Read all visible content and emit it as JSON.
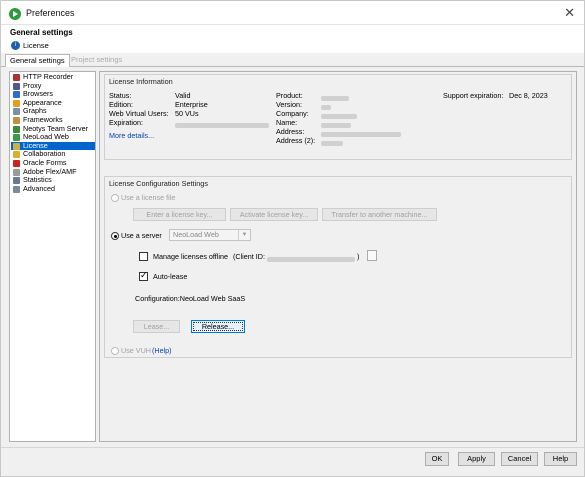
{
  "window": {
    "title": "Preferences",
    "close_glyph": "✕"
  },
  "header": {
    "title": "General settings",
    "subtitle": "License",
    "icon": "info-icon"
  },
  "tabs": [
    {
      "label": "General settings",
      "active": true
    },
    {
      "label": "Project settings",
      "active": false
    }
  ],
  "tree": {
    "items": [
      {
        "label": "HTTP Recorder",
        "icon": "recorder-icon",
        "color": "#b03030"
      },
      {
        "label": "Proxy",
        "icon": "proxy-icon",
        "color": "#555588"
      },
      {
        "label": "Browsers",
        "icon": "browser-icon",
        "color": "#2a6fc9"
      },
      {
        "label": "Appearance",
        "icon": "palette-icon",
        "color": "#e0a020"
      },
      {
        "label": "Graphs",
        "icon": "graph-icon",
        "color": "#7a8fa8"
      },
      {
        "label": "Frameworks",
        "icon": "framework-icon",
        "color": "#c0903a"
      },
      {
        "label": "Neotys Team Server",
        "icon": "team-server-icon",
        "color": "#3a8a3a"
      },
      {
        "label": "NeoLoad Web",
        "icon": "neoload-web-icon",
        "color": "#3a9a4a"
      },
      {
        "label": "License",
        "icon": "key-icon",
        "color": "#d0b040",
        "selected": true
      },
      {
        "label": "Collaboration",
        "icon": "collaboration-icon",
        "color": "#d8b030"
      },
      {
        "label": "Oracle Forms",
        "icon": "oracle-icon",
        "color": "#cc2222"
      },
      {
        "label": "Adobe Flex/AMF",
        "icon": "flex-icon",
        "color": "#9a9a9a"
      },
      {
        "label": "Statistics",
        "icon": "statistics-icon",
        "color": "#6a7a8a"
      },
      {
        "label": "Advanced",
        "icon": "advanced-icon",
        "color": "#7a8a9a"
      }
    ]
  },
  "license_info": {
    "title": "License Information",
    "status_label": "Status:",
    "status_value": "Valid",
    "edition_label": "Edition:",
    "edition_value": "Enterprise",
    "vus_label": "Web Virtual Users:",
    "vus_value": "50 VUs",
    "expiration_label": "Expiration:",
    "more_details": "More details...",
    "product_label": "Product:",
    "version_label": "Version:",
    "company_label": "Company:",
    "name_label": "Name:",
    "address_label": "Address:",
    "address2_label": "Address (2):",
    "support_label": "Support expiration:",
    "support_value": "Dec 8, 2023"
  },
  "config": {
    "title": "License Configuration Settings",
    "use_license_file": "Use a license file",
    "enter_key": "Enter a license key...",
    "activate_key": "Activate license key...",
    "transfer": "Transfer to another machine...",
    "use_server": "Use a server",
    "server_value": "NeoLoad Web",
    "manage_offline": "Manage licenses offline",
    "client_id_label": "(Client ID:",
    "client_id_end": ")",
    "auto_lease": "Auto-lease",
    "configuration": "Configuration:NeoLoad Web SaaS",
    "lease": "Lease...",
    "release": "Release...",
    "use_vuh": "Use VUH",
    "help": "(Help)"
  },
  "footer": {
    "ok": "OK",
    "apply": "Apply",
    "cancel": "Cancel",
    "help": "Help"
  }
}
